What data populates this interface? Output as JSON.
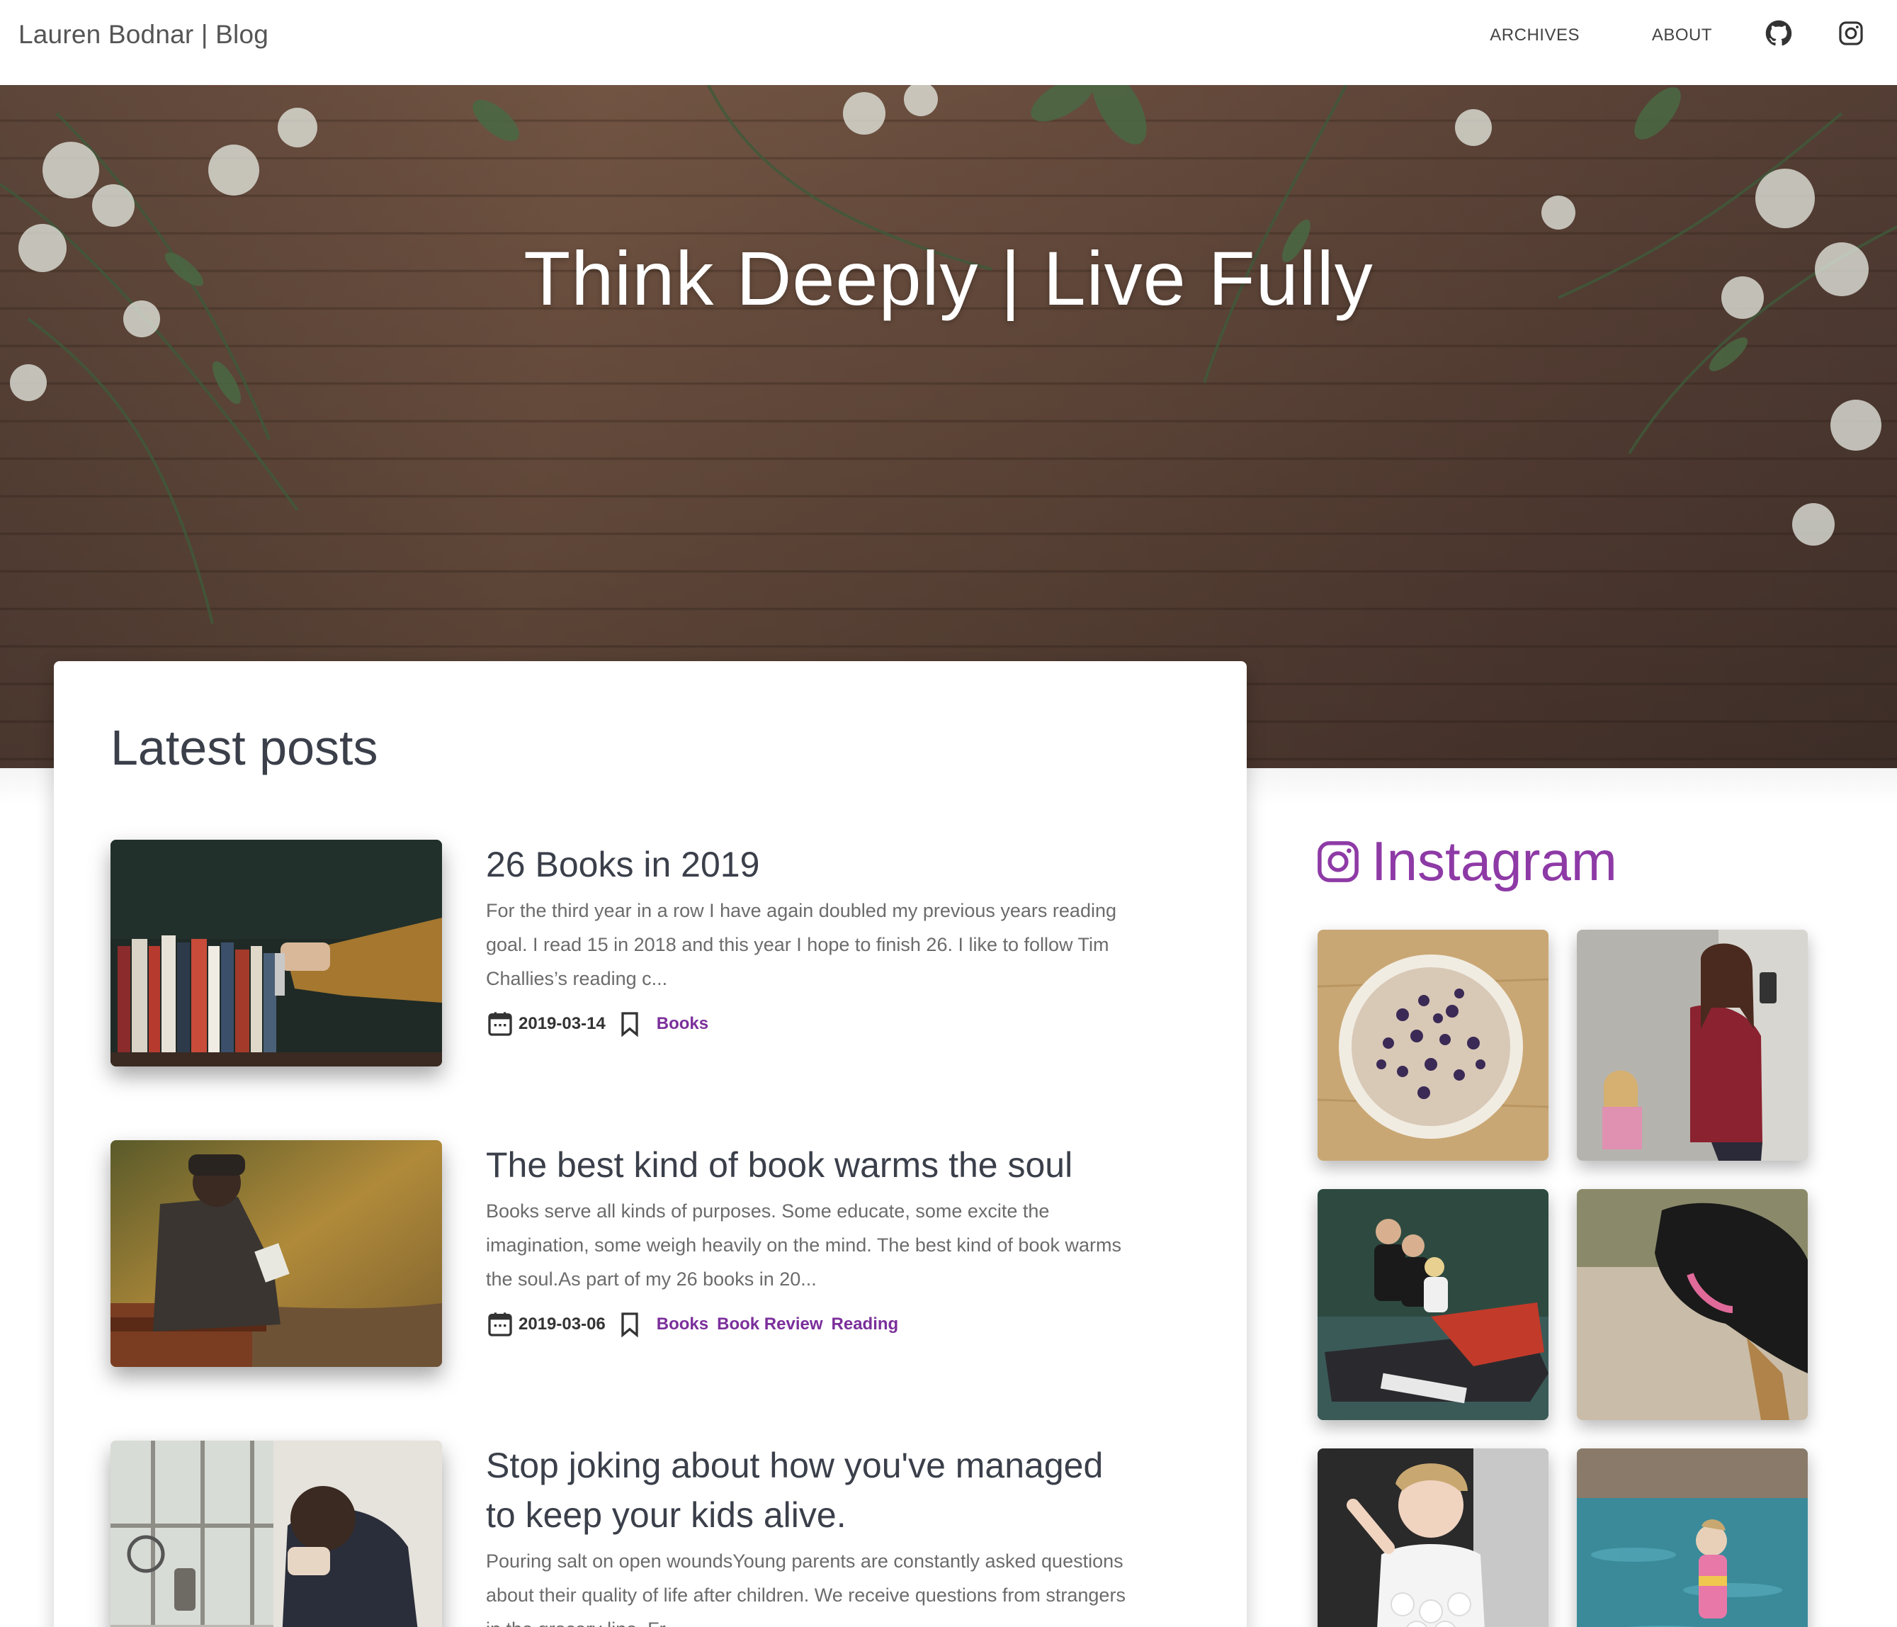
{
  "navbar": {
    "brand": "Lauren Bodnar | Blog",
    "links": [
      {
        "label": "ARCHIVES"
      },
      {
        "label": "ABOUT"
      }
    ],
    "icons": [
      "github-icon",
      "instagram-icon"
    ]
  },
  "hero": {
    "title": "Think Deeply | Live Fully"
  },
  "main": {
    "section_title": "Latest posts",
    "posts": [
      {
        "title": "26 Books in 2019",
        "excerpt": "For the third year in a row I have again doubled my previous years reading goal. I read 15 in 2018 and this year I hope to finish 26. I like to follow Tim Challies’s reading c...",
        "date": "2019-03-14",
        "tags": [
          "Books"
        ]
      },
      {
        "title": "The best kind of book warms the soul",
        "excerpt": "Books serve all kinds of purposes. Some educate, some excite the imagination, some weigh heavily on the mind. The best kind of book warms the soul.As part of my 26 books in 20...",
        "date": "2019-03-06",
        "tags": [
          "Books",
          "Book Review",
          "Reading"
        ]
      },
      {
        "title": "Stop joking about how you've managed to keep your kids alive.",
        "excerpt": "Pouring salt on open woundsYoung parents are constantly asked questions about their quality of life after children. We receive questions from strangers in the grocery line. Fr...",
        "date": "",
        "tags": []
      }
    ]
  },
  "sidebar": {
    "instagram_title": "Instagram",
    "photos": [
      "blueberry-pie",
      "mirror-selfie",
      "jet-ski",
      "dog-on-sand",
      "child-dancing",
      "child-at-pool"
    ]
  },
  "colors": {
    "accent": "#7b2f9b",
    "instagram": "#8e3aa6",
    "text": "#3a3f4a"
  }
}
